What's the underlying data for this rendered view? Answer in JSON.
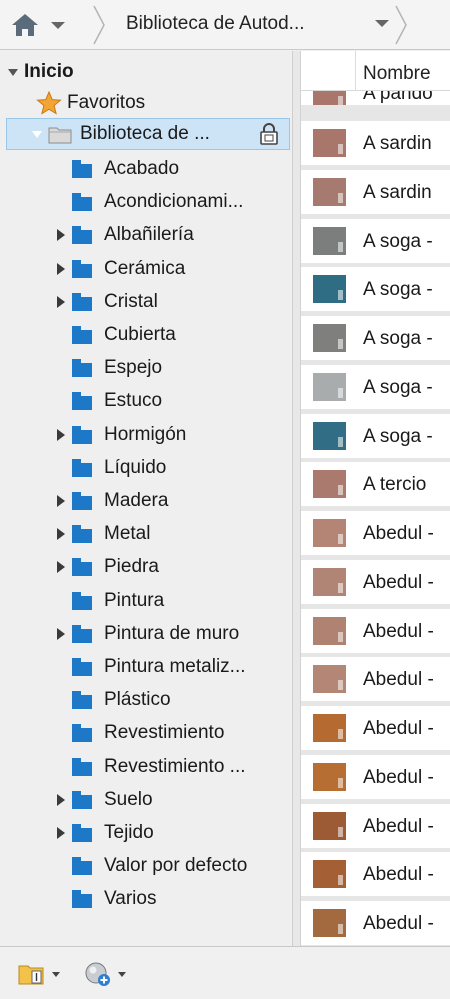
{
  "breadcrumb": {
    "current_label": "Biblioteca de Autod...",
    "home_icon": "home-icon"
  },
  "tree": {
    "root_label": "Inicio",
    "favorites_label": "Favoritos",
    "library_label": "Biblioteca de ...",
    "categories": [
      {
        "label": "Acabado",
        "expandable": false
      },
      {
        "label": "Acondicionami...",
        "expandable": false
      },
      {
        "label": "Albañilería",
        "expandable": true
      },
      {
        "label": "Cerámica",
        "expandable": true
      },
      {
        "label": "Cristal",
        "expandable": true
      },
      {
        "label": "Cubierta",
        "expandable": false
      },
      {
        "label": "Espejo",
        "expandable": false
      },
      {
        "label": "Estuco",
        "expandable": false
      },
      {
        "label": "Hormigón",
        "expandable": true
      },
      {
        "label": "Líquido",
        "expandable": false
      },
      {
        "label": "Madera",
        "expandable": true
      },
      {
        "label": "Metal",
        "expandable": true
      },
      {
        "label": "Piedra",
        "expandable": true
      },
      {
        "label": "Pintura",
        "expandable": false
      },
      {
        "label": "Pintura de muro",
        "expandable": true
      },
      {
        "label": "Pintura metaliz...",
        "expandable": false
      },
      {
        "label": "Plástico",
        "expandable": false
      },
      {
        "label": "Revestimiento",
        "expandable": false
      },
      {
        "label": "Revestimiento ...",
        "expandable": false
      },
      {
        "label": "Suelo",
        "expandable": true
      },
      {
        "label": "Tejido",
        "expandable": true
      },
      {
        "label": "Valor por defecto",
        "expandable": false
      },
      {
        "label": "Varios",
        "expandable": false
      }
    ]
  },
  "list": {
    "column_name": "Nombre",
    "partial_top_item": "A pando",
    "items": [
      {
        "name": "A sardin",
        "color": "#a8766a"
      },
      {
        "name": "A sardin",
        "color": "#a67a6e"
      },
      {
        "name": "A soga -",
        "color": "#7b7e7c"
      },
      {
        "name": "A soga -",
        "color": "#2f6d84"
      },
      {
        "name": "A soga -",
        "color": "#7f807e"
      },
      {
        "name": "A soga -",
        "color": "#a9acad"
      },
      {
        "name": "A soga -",
        "color": "#316e85"
      },
      {
        "name": "A tercio",
        "color": "#a97a6d"
      },
      {
        "name": "Abedul -",
        "color": "#b48474"
      },
      {
        "name": "Abedul -",
        "color": "#b18575"
      },
      {
        "name": "Abedul -",
        "color": "#b08272"
      },
      {
        "name": "Abedul -",
        "color": "#b48676"
      },
      {
        "name": "Abedul -",
        "color": "#b46a30"
      },
      {
        "name": "Abedul -",
        "color": "#b76e33"
      },
      {
        "name": "Abedul -",
        "color": "#9c5a35"
      },
      {
        "name": "Abedul -",
        "color": "#a55f34"
      },
      {
        "name": "Abedul -",
        "color": "#a36a3f"
      }
    ]
  },
  "colors": {
    "selection": "#cde4f7",
    "category_icon": "#1e78c8",
    "favorites_star": "#f2a533"
  }
}
